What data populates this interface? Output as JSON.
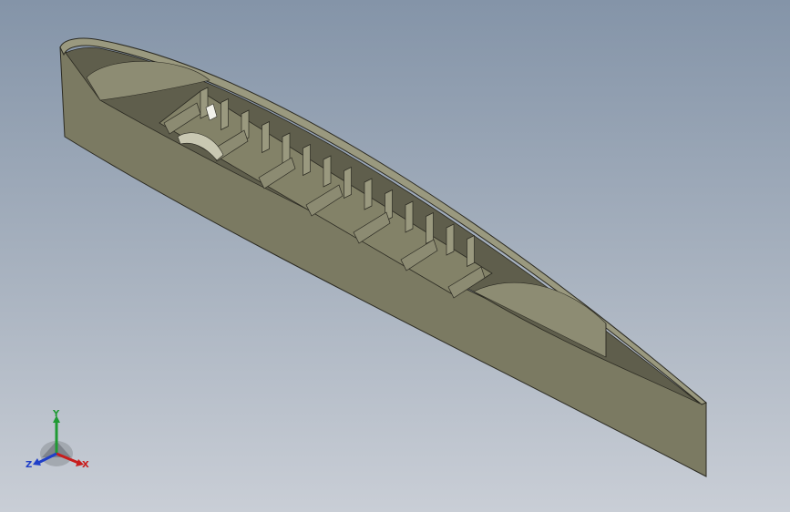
{
  "viewport": {
    "background_top": "#8494a8",
    "background_bottom": "#c9ced6"
  },
  "model": {
    "shell_color": "#7b7a62",
    "interior_color": "#5f5e4c",
    "rib_color": "#8c8b72",
    "edge_color": "#2b2a22"
  },
  "triad": {
    "x_label": "X",
    "y_label": "Y",
    "z_label": "Z",
    "x_color": "#c81d1d",
    "y_color": "#1f9a33",
    "z_color": "#1f3fc8"
  }
}
